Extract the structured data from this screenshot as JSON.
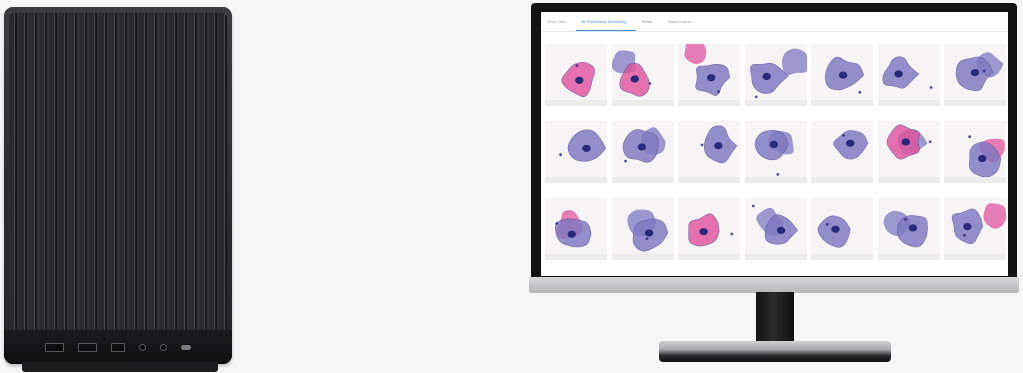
{
  "app": {
    "tabs": [
      {
        "label": "Slide View",
        "active": false
      },
      {
        "label": "AI Preliminary Screening",
        "active": true
      },
      {
        "label": "Notes",
        "active": false
      },
      {
        "label": "Batch Export",
        "active": false
      }
    ]
  },
  "colors": {
    "accent": "#3d8ddd",
    "pink_stain": "#e0559e",
    "blue_stain": "#7e78c0",
    "nucleus": "#2a2a7a",
    "tile_background": "#f7f4f6"
  },
  "hardware": {
    "tower_icons": [
      "usb-port-icon",
      "usb-port-icon",
      "usb-c-port-icon",
      "audio-jack-icon",
      "audio-jack-icon",
      "power-button-icon"
    ]
  },
  "cells": [
    {
      "type": "pink"
    },
    {
      "type": "pink"
    },
    {
      "type": "mixed"
    },
    {
      "type": "blue"
    },
    {
      "type": "blue"
    },
    {
      "type": "blue"
    },
    {
      "type": "blue"
    },
    {
      "type": "blue"
    },
    {
      "type": "blue"
    },
    {
      "type": "blue"
    },
    {
      "type": "blue"
    },
    {
      "type": "blue"
    },
    {
      "type": "pink"
    },
    {
      "type": "mixed"
    },
    {
      "type": "mixed"
    },
    {
      "type": "blue"
    },
    {
      "type": "pink"
    },
    {
      "type": "blue"
    },
    {
      "type": "blue"
    },
    {
      "type": "blue"
    },
    {
      "type": "mixed"
    }
  ]
}
